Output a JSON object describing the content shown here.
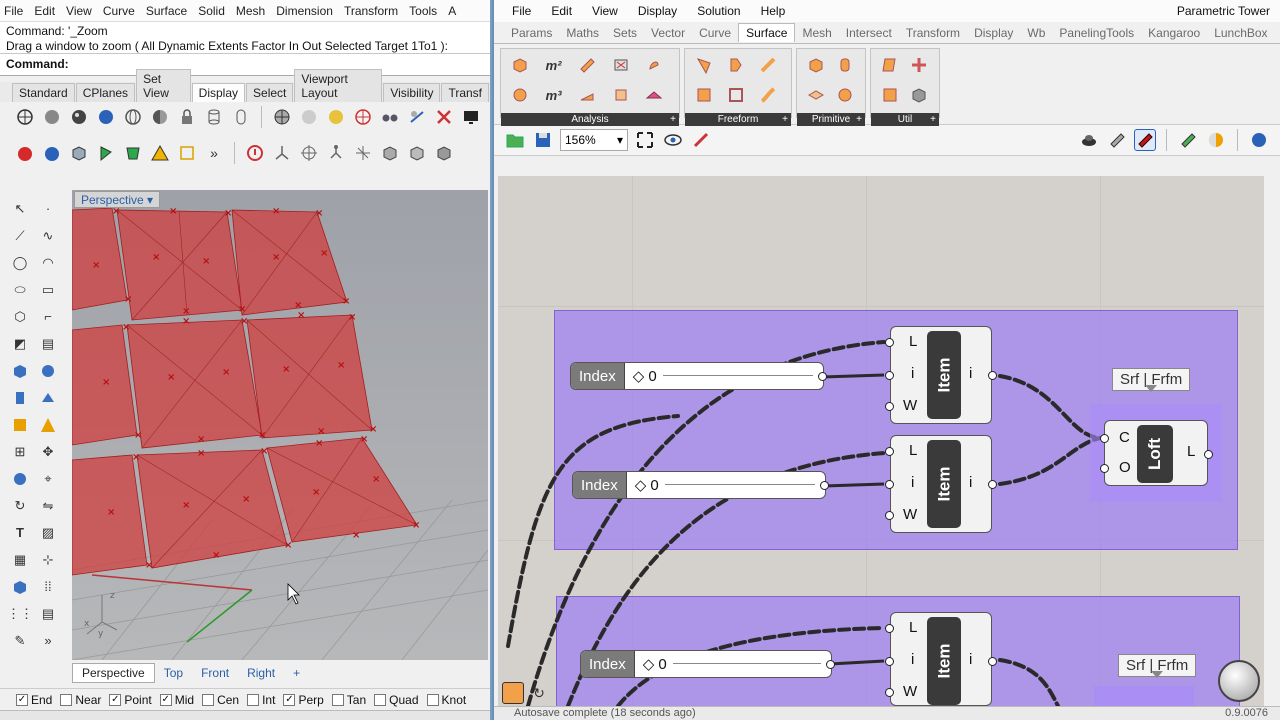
{
  "rhino": {
    "menu": [
      "File",
      "Edit",
      "View",
      "Curve",
      "Surface",
      "Solid",
      "Mesh",
      "Dimension",
      "Transform",
      "Tools",
      "A"
    ],
    "command_history": [
      "Command: '_Zoom",
      "Drag a window to zoom ( All  Dynamic  Extents  Factor  In  Out  Selected  Target  1To1 ):"
    ],
    "command_prompt": "Command:",
    "toolbar_tabs": [
      "Standard",
      "CPlanes",
      "Set View",
      "Display",
      "Select",
      "Viewport Layout",
      "Visibility",
      "Transf"
    ],
    "active_toolbar_tab": "Display",
    "viewport_title": "Perspective",
    "viewport_tabs": [
      "Perspective",
      "Top",
      "Front",
      "Right"
    ],
    "viewport_tab_add": "+",
    "osnaps": [
      {
        "label": "End",
        "checked": true
      },
      {
        "label": "Near",
        "checked": false
      },
      {
        "label": "Point",
        "checked": true
      },
      {
        "label": "Mid",
        "checked": true
      },
      {
        "label": "Cen",
        "checked": false
      },
      {
        "label": "Int",
        "checked": false
      },
      {
        "label": "Perp",
        "checked": true
      },
      {
        "label": "Tan",
        "checked": false
      },
      {
        "label": "Quad",
        "checked": false
      },
      {
        "label": "Knot",
        "checked": false
      }
    ],
    "axis_labels": {
      "z": "z",
      "y": "y",
      "x": "x"
    }
  },
  "grasshopper": {
    "menu": [
      "File",
      "Edit",
      "View",
      "Display",
      "Solution",
      "Help"
    ],
    "document_name": "Parametric Tower",
    "tabs": [
      "Params",
      "Maths",
      "Sets",
      "Vector",
      "Curve",
      "Surface",
      "Mesh",
      "Intersect",
      "Transform",
      "Display",
      "Wb",
      "PanelingTools",
      "Kangaroo",
      "LunchBox"
    ],
    "active_tab": "Surface",
    "panels": [
      {
        "label": "Analysis",
        "icon_labels": [
          "",
          "m²",
          "",
          "",
          "",
          "",
          "m³",
          "",
          "",
          ""
        ]
      },
      {
        "label": "Freeform"
      },
      {
        "label": "Primitive"
      },
      {
        "label": "Util"
      }
    ],
    "zoom": "156%",
    "sliders": [
      {
        "name": "Index",
        "value": "0"
      },
      {
        "name": "Index",
        "value": "0"
      },
      {
        "name": "Index",
        "value": "0"
      }
    ],
    "item_component": {
      "name": "Item",
      "inputs": [
        "L",
        "i",
        "W"
      ],
      "output": "i"
    },
    "loft_component": {
      "name": "Loft",
      "inputs": [
        "C",
        "O"
      ],
      "output": "L"
    },
    "bubble_text": "Srf | Frfm",
    "status_text": "Autosave complete (18 seconds ago)",
    "version_text": "0.9.0076"
  },
  "colors": {
    "group_fill": "#a082f0",
    "panel_red": "#c0392b",
    "selection_blue": "#2a5fa8"
  }
}
